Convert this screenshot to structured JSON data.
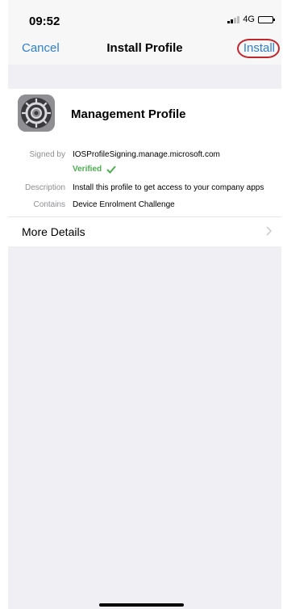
{
  "status_bar": {
    "time": "09:52",
    "network": "4G"
  },
  "nav": {
    "cancel_label": "Cancel",
    "title": "Install Profile",
    "install_label": "Install"
  },
  "profile": {
    "name": "Management Profile",
    "signed_by_label": "Signed by",
    "signed_by_value": "IOSProfileSigning.manage.microsoft.com",
    "verified_label": "Verified",
    "description_label": "Description",
    "description_value": "Install this profile to get access to your company apps",
    "contains_label": "Contains",
    "contains_value": "Device Enrolment Challenge"
  },
  "more_details": {
    "label": "More Details"
  },
  "colors": {
    "accent": "#2f7fd1",
    "verified": "#4cae4f",
    "highlight": "#c0262c"
  },
  "icons": [
    "settings-gear-icon",
    "checkmark-icon",
    "chevron-right-icon",
    "signal-icon",
    "battery-icon"
  ]
}
